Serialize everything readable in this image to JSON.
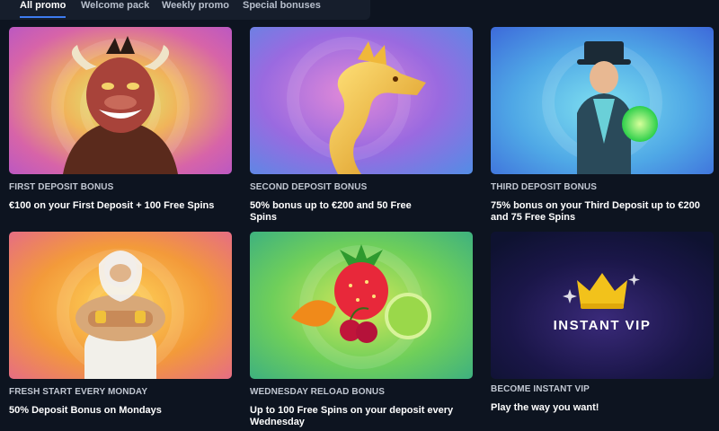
{
  "tabs": [
    {
      "label": "All promo",
      "active": true
    },
    {
      "label": "Welcome pack",
      "active": false
    },
    {
      "label": "Weekly promo",
      "active": false
    },
    {
      "label": "Special bonuses",
      "active": false
    }
  ],
  "promos": [
    {
      "category": "FIRST DEPOSIT BONUS",
      "title": "€100 on your First Deposit + 100 Free Spins",
      "art": "bull-mascot"
    },
    {
      "category": "SECOND DEPOSIT BONUS",
      "title": "50% bonus up to €200 and 50 Free Spins",
      "art": "golden-dragon"
    },
    {
      "category": "THIRD DEPOSIT BONUS",
      "title": "75% bonus on your Third Deposit up to €200 and 75 Free Spins",
      "art": "magician"
    },
    {
      "category": "FRESH START EVERY MONDAY",
      "title": "50% Deposit Bonus on Mondays",
      "art": "zeus"
    },
    {
      "category": "WEDNESDAY RELOAD BONUS",
      "title": "Up to 100 Free Spins on your deposit every Wednesday",
      "art": "fruits"
    },
    {
      "category": "BECOME INSTANT VIP",
      "title": "Play the way you want!",
      "art": "crown",
      "banner_text": "INSTANT VIP"
    }
  ],
  "colors": {
    "background": "#0d1420",
    "tab_active_underline": "#3d7bf0",
    "crown_gold": "#f2c21b"
  }
}
